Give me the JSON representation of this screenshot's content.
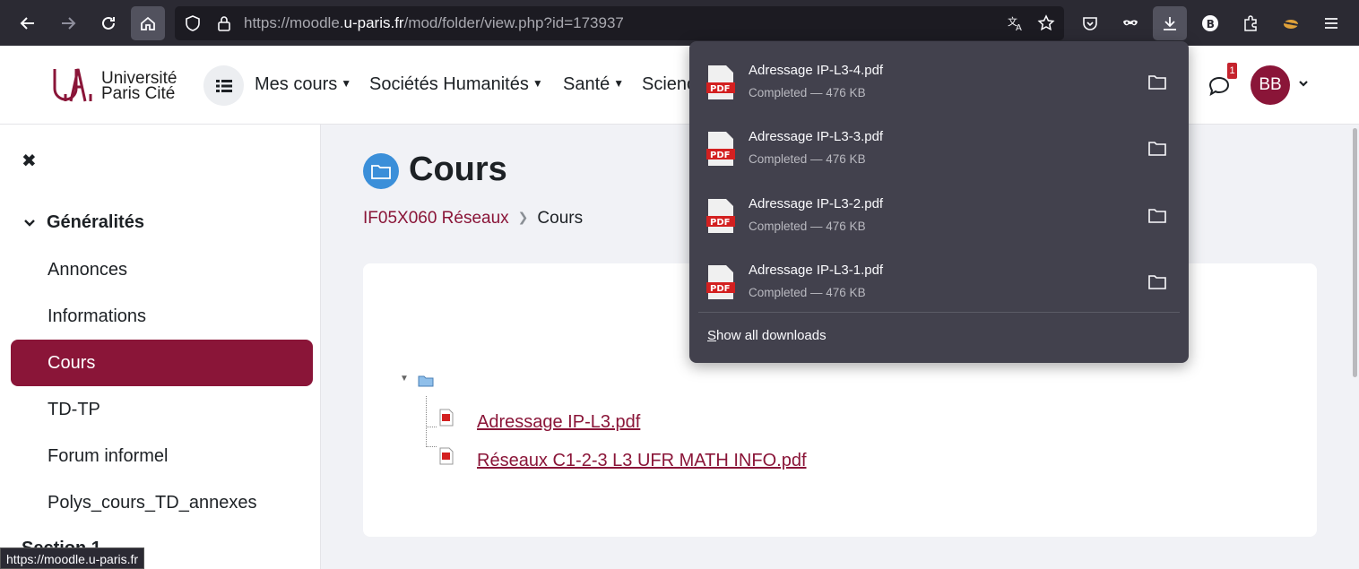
{
  "browser": {
    "url_prefix": "https://moodle.",
    "url_domain": "u-paris.fr",
    "url_path": "/mod/folder/view.php?id=173937",
    "profile_letter": "B"
  },
  "header": {
    "logo_line1": "Université",
    "logo_line2": "Paris Cité",
    "nav": [
      {
        "label": "Mes cours"
      },
      {
        "label": "Sociétés Humanités"
      },
      {
        "label": "Santé"
      },
      {
        "label": "Scienc"
      }
    ],
    "notif_count": "1",
    "avatar": "BB"
  },
  "sidebar": {
    "close": "✖",
    "section_title": "Généralités",
    "items": [
      {
        "label": "Annonces"
      },
      {
        "label": "Informations"
      },
      {
        "label": "Cours"
      },
      {
        "label": "TD-TP"
      },
      {
        "label": "Forum informel"
      },
      {
        "label": "Polys_cours_TD_annexes"
      }
    ],
    "next_section": "Section 1"
  },
  "main": {
    "title": "Cours",
    "breadcrumb": {
      "course": "IF05X060 Réseaux",
      "current": "Cours"
    },
    "files": [
      {
        "name": "Adressage IP-L3.pdf"
      },
      {
        "name": "Réseaux C1-2-3 L3 UFR MATH INFO.pdf"
      }
    ]
  },
  "downloads": {
    "items": [
      {
        "name": "Adressage IP-L3-4.pdf",
        "status": "Completed — 476 KB"
      },
      {
        "name": "Adressage IP-L3-3.pdf",
        "status": "Completed — 476 KB"
      },
      {
        "name": "Adressage IP-L3-2.pdf",
        "status": "Completed — 476 KB"
      },
      {
        "name": "Adressage IP-L3-1.pdf",
        "status": "Completed — 476 KB"
      }
    ],
    "show_all_first": "S",
    "show_all_rest": "how all downloads",
    "pdf_label": "PDF"
  },
  "status_bar": {
    "url": "https://moodle.u-paris.fr"
  },
  "colors": {
    "brand": "#8a1538",
    "browser_bg": "#2b2a33",
    "panel_bg": "#42414d"
  }
}
